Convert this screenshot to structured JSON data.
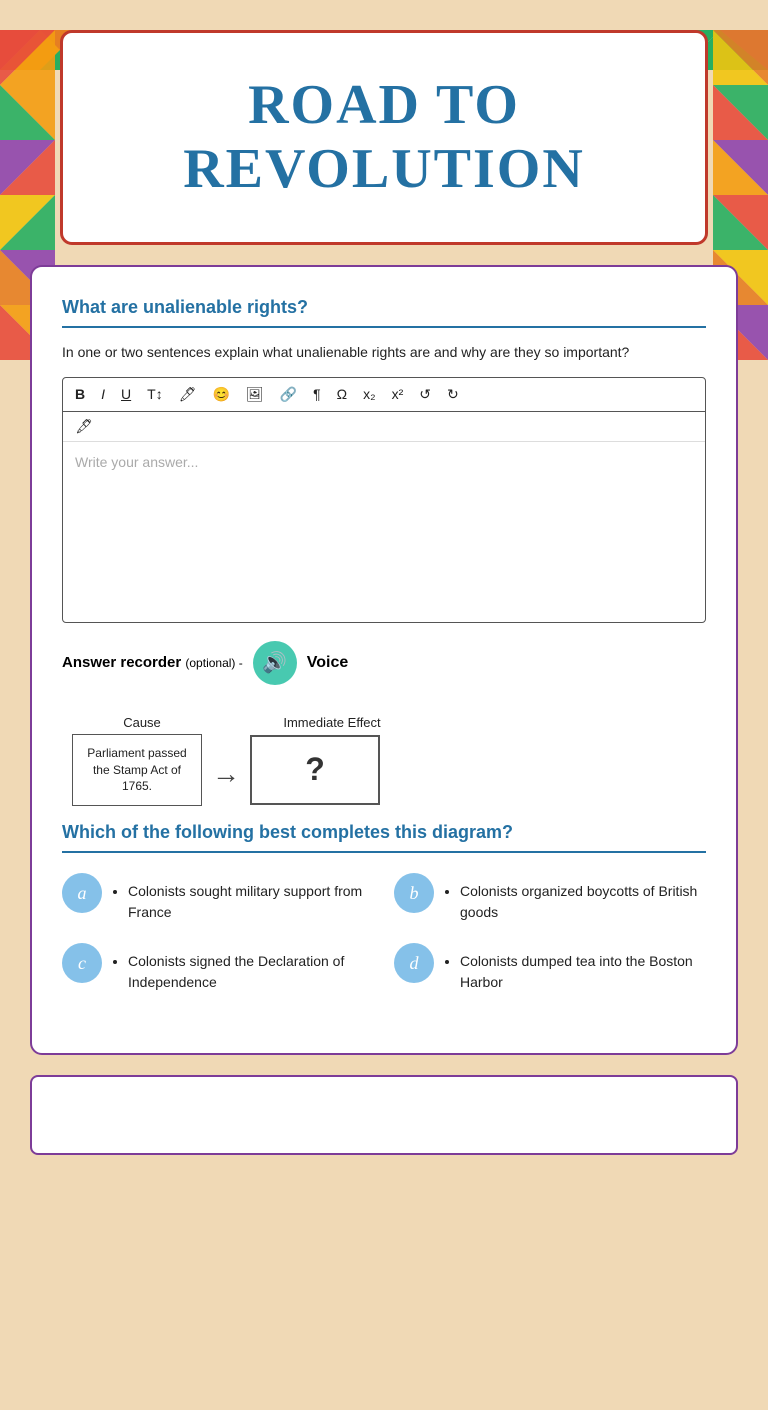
{
  "page": {
    "title": "ROAD TO\nREVOLUTION",
    "title_line1": "ROAD TO",
    "title_line2": "REVOLUTION",
    "background_color": "#f0d9b5"
  },
  "question1": {
    "title": "What are unalienable rights?",
    "instruction": "In one or two sentences explain what unalienable rights are and why are they so  important?",
    "editor_placeholder": "Write your answer...",
    "toolbar": {
      "bold": "B",
      "italic": "I",
      "underline": "U",
      "font_size": "T↕",
      "color": "🖊",
      "emoji": "😊",
      "image": "🖼",
      "link": "🔗",
      "paragraph": "¶",
      "omega": "Ω",
      "subscript": "x₂",
      "superscript": "x²",
      "undo": "↺",
      "redo": "↻",
      "eraser": "🖋"
    },
    "answer_recorder_label": "Answer recorder",
    "answer_recorder_optional": "(optional) -",
    "voice_label": "Voice"
  },
  "question2": {
    "diagram": {
      "cause_label": "Cause",
      "effect_label": "Immediate Effect",
      "cause_text": "Parliament passed the Stamp Act of 1765.",
      "effect_placeholder": "?"
    },
    "title": "Which of the following best completes this diagram?",
    "choices": [
      {
        "id": "a",
        "text": "Colonists sought military support from France"
      },
      {
        "id": "b",
        "text": "Colonists organized boycotts of British goods"
      },
      {
        "id": "c",
        "text": "Colonists signed the Declaration of Independence"
      },
      {
        "id": "d",
        "text": "Colonists dumped tea into the Boston Harbor"
      }
    ]
  },
  "colors": {
    "accent_blue": "#2471a3",
    "accent_light_blue": "#85c1e9",
    "accent_teal": "#48c9b0",
    "border_purple": "#7d3c98",
    "border_red": "#c0392b"
  }
}
